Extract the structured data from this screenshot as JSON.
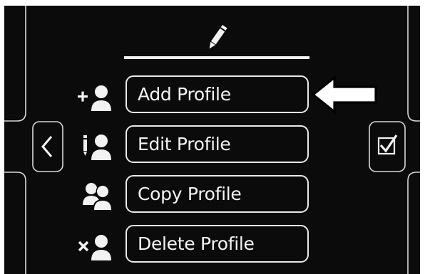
{
  "header": {
    "icon": "pencil-icon"
  },
  "menu": {
    "items": [
      {
        "label": "Add Profile",
        "icon": "add-user-icon"
      },
      {
        "label": "Edit Profile",
        "icon": "edit-user-icon"
      },
      {
        "label": "Copy Profile",
        "icon": "copy-users-icon"
      },
      {
        "label": "Delete Profile",
        "icon": "delete-user-icon"
      }
    ]
  },
  "navigation": {
    "back_icon": "chevron-left-icon",
    "confirm_icon": "checkbox-icon"
  },
  "annotation": {
    "pointer_icon": "arrow-left-icon",
    "points_to": "Add Profile"
  },
  "colors": {
    "background": "#0b0b0b",
    "foreground": "#f2f2f2",
    "outline": "#e9e9e9"
  }
}
